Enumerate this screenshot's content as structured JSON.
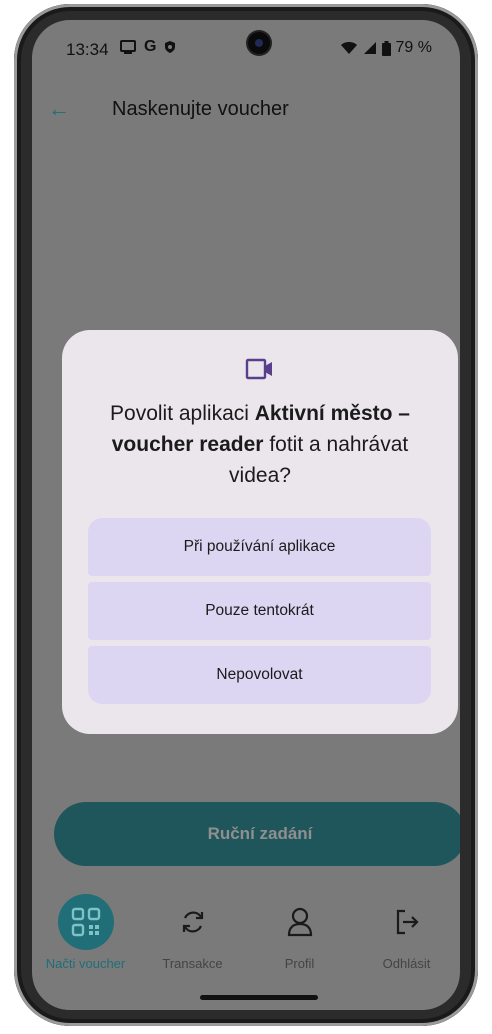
{
  "status_bar": {
    "time": "13:34",
    "battery": "79 %",
    "g_label": "G"
  },
  "app_bar": {
    "title": "Naskenujte voucher"
  },
  "dialog": {
    "title_prefix": "Povolit aplikaci ",
    "app_name": "Aktivní město – voucher reader",
    "title_suffix": " fotit a nahrávat videa?",
    "buttons": {
      "while_using": "Při používání aplikace",
      "only_once": "Pouze tentokrát",
      "deny": "Nepovolovat"
    }
  },
  "manual_entry": {
    "label": "Ruční zadání"
  },
  "bottom_nav": {
    "items": [
      {
        "label": "Načti voucher",
        "icon": "qr-code-icon"
      },
      {
        "label": "Transakce",
        "icon": "refresh-icon"
      },
      {
        "label": "Profil",
        "icon": "person-icon"
      },
      {
        "label": "Odhlásit",
        "icon": "logout-icon"
      }
    ]
  },
  "colors": {
    "accent": "#1f6e78",
    "dialog_bg": "#ebe6ec",
    "button_bg": "#dcd6f3",
    "scrim": "#7a7a7a"
  }
}
